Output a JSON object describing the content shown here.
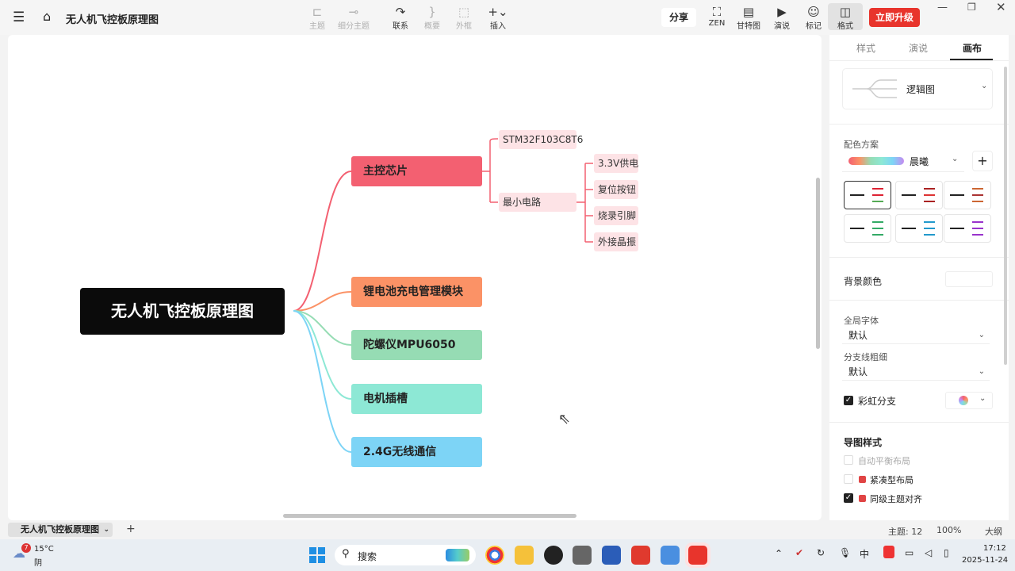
{
  "app": {
    "title": "无人机飞控板原理图",
    "upgrade": "立即升级"
  },
  "toolbar": {
    "topic": "主题",
    "subtopic": "细分主题",
    "relation": "联系",
    "summary": "概要",
    "boundary": "外框",
    "insert": "插入",
    "share": "分享",
    "zen": "ZEN",
    "gantt": "甘特图",
    "present": "演说",
    "marker": "标记",
    "format": "格式"
  },
  "mindmap": {
    "root": "无人机飞控板原理图",
    "branches": [
      {
        "label": "主控芯片",
        "color": "#f36071"
      },
      {
        "label": "锂电池充电管理模块",
        "color": "#fb9266"
      },
      {
        "label": "陀螺仪MPU6050",
        "color": "#96dcb4"
      },
      {
        "label": "电机插槽",
        "color": "#8de8d5"
      },
      {
        "label": "2.4G无线通信",
        "color": "#7dd4f6"
      }
    ],
    "chip_children": [
      "STM32F103C8T6",
      "最小电路"
    ],
    "min_circuit_children": [
      "3.3V供电",
      "复位按钮",
      "烧录引脚",
      "外接晶振"
    ]
  },
  "panel": {
    "tabs": [
      "样式",
      "演说",
      "画布"
    ],
    "structure": "逻辑图",
    "color_scheme_label": "配色方案",
    "color_scheme": "晨曦",
    "bg_color_label": "背景颜色",
    "global_font_label": "全局字体",
    "global_font": "默认",
    "branch_width_label": "分支线粗细",
    "branch_width": "默认",
    "rainbow_branch": "彩虹分支",
    "map_style_label": "导图样式",
    "auto_balance": "自动平衡布局",
    "compact": "紧凑型布局",
    "align_same_level": "同级主题对齐"
  },
  "statusbar": {
    "sheet": "无人机飞控板原理图",
    "topics": "主题: 12",
    "zoom": "100%",
    "size": "大纲"
  },
  "taskbar": {
    "weather_temp": "15°C",
    "weather_desc": "阴",
    "weather_badge": "7",
    "search": "搜索",
    "time": "17:12",
    "date": "2025-11-24"
  }
}
